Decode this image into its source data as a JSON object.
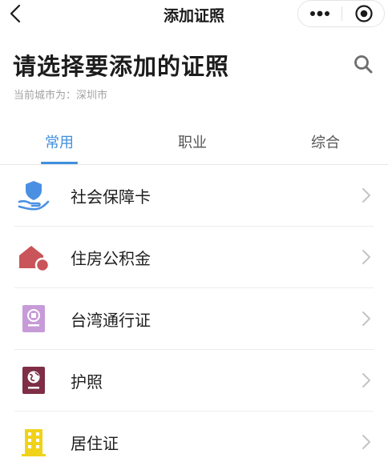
{
  "nav": {
    "title": "添加证照",
    "back_icon": "chevron-left-icon",
    "more_icon": "more-dots-icon",
    "close_icon": "target-close-icon"
  },
  "header": {
    "title": "请选择要添加的证照",
    "city": "当前城市为：深圳市",
    "search_icon": "search-icon"
  },
  "tabs": [
    {
      "label": "常用",
      "active": true
    },
    {
      "label": "职业",
      "active": false
    },
    {
      "label": "综合",
      "active": false
    }
  ],
  "items": [
    {
      "label": "社会保障卡",
      "icon": "social-security-hand-icon",
      "color": "#4a90e2"
    },
    {
      "label": "住房公积金",
      "icon": "house-fund-icon",
      "color": "#c9545a"
    },
    {
      "label": "台湾通行证",
      "icon": "taiwan-pass-icon",
      "color": "#c79bd8"
    },
    {
      "label": "护照",
      "icon": "passport-globe-icon",
      "color": "#7f2e45"
    },
    {
      "label": "居住证",
      "icon": "residence-building-icon",
      "color": "#f1d21b"
    }
  ],
  "colors": {
    "accent": "#3f8fdd",
    "text": "#1e1e1e",
    "muted": "#a3a3a3"
  }
}
